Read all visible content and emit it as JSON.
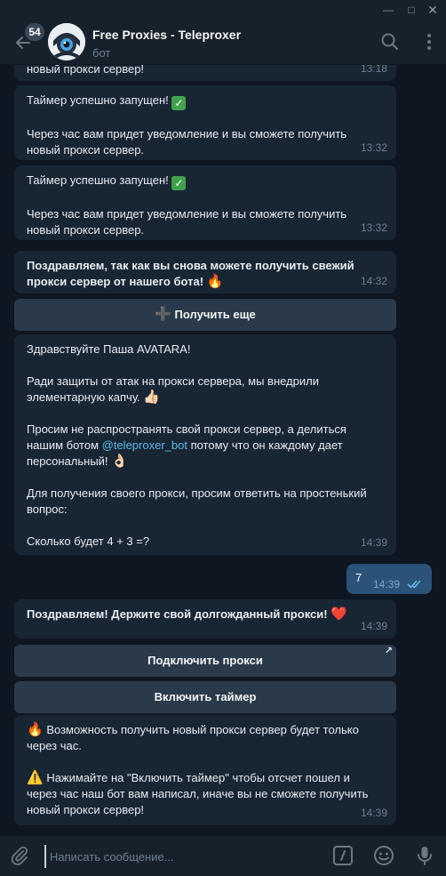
{
  "window": {
    "minimize_glyph": "—",
    "maximize_glyph": "□",
    "close_glyph": "✕"
  },
  "header": {
    "unread_count": "54",
    "title": "Free Proxies - Teleproxer",
    "subtitle": "бот",
    "icons": [
      "back-arrow-icon",
      "search-icon",
      "kebab-menu-icon"
    ]
  },
  "messages": [
    {
      "text": "новый прокси сервер!",
      "time": "13:18"
    },
    {
      "text_line1": "Таймер успешно запущен!",
      "emoji": "✅",
      "text_rest": "Через час вам придет уведомление и вы сможете получить новый прокси сервер.",
      "time": "13:32"
    },
    {
      "text_line1": "Таймер успешно запущен!",
      "emoji": "✅",
      "text_rest": "Через час вам придет уведомление и вы сможете получить новый прокси сервер.",
      "time": "13:32"
    },
    {
      "text": "Поздравляем, так как вы снова можете получить свежий прокси сервер от нашего бота!",
      "emoji": "🔥",
      "time": "14:32"
    },
    {
      "greeting": "Здравствуйте Паша AVATARA!",
      "p1": "Ради защиты от атак на прокси сервера, мы внедрили элементарную капчу.",
      "p1_emoji": "👍🏻",
      "p2_before": "Просим не распространять свой прокси сервер, а делиться нашим ботом ",
      "p2_link": "@teleproxer_bot",
      "p2_after": " потому что он каждому дает персональный!",
      "p2_emoji": "👌🏻",
      "p3": "Для получения своего прокси, просим ответить на простенький вопрос:",
      "p4": "Сколько будет 4 + 3 =?",
      "time": "14:39"
    },
    {
      "text": "Поздравляем! Держите свой долгожданный прокси!",
      "emoji": "❤️",
      "time": "14:39"
    },
    {
      "p1_emoji": "🔥",
      "p1": "Возможность получить новый прокси сервер будет только через час.",
      "p2_emoji": "⚠️",
      "p2": "Нажимайте на \"Включить таймер\" чтобы отсчет пошел и через час наш бот вам написал, иначе вы не сможете получить новый прокси сервер!",
      "time": "14:39"
    }
  ],
  "outgoing": {
    "text": "7",
    "time": "14:39"
  },
  "buttons": {
    "get_more_icon": "➕",
    "get_more": "Получить еще",
    "connect_proxy": "Подключить прокси",
    "enable_timer": "Включить таймер",
    "external_glyph": "↗"
  },
  "composer": {
    "placeholder": "Написать сообщение...",
    "icons": [
      "paperclip-icon",
      "slash-command-icon",
      "emoji-icon",
      "microphone-icon"
    ]
  },
  "colors": {
    "background": "#0e1621",
    "header": "#17212b",
    "bubble_in": "#182533",
    "bubble_out": "#2b5278",
    "keyboard_button": "#2b3a4a",
    "link": "#5fb9e8",
    "time": "#6d7f8f"
  }
}
